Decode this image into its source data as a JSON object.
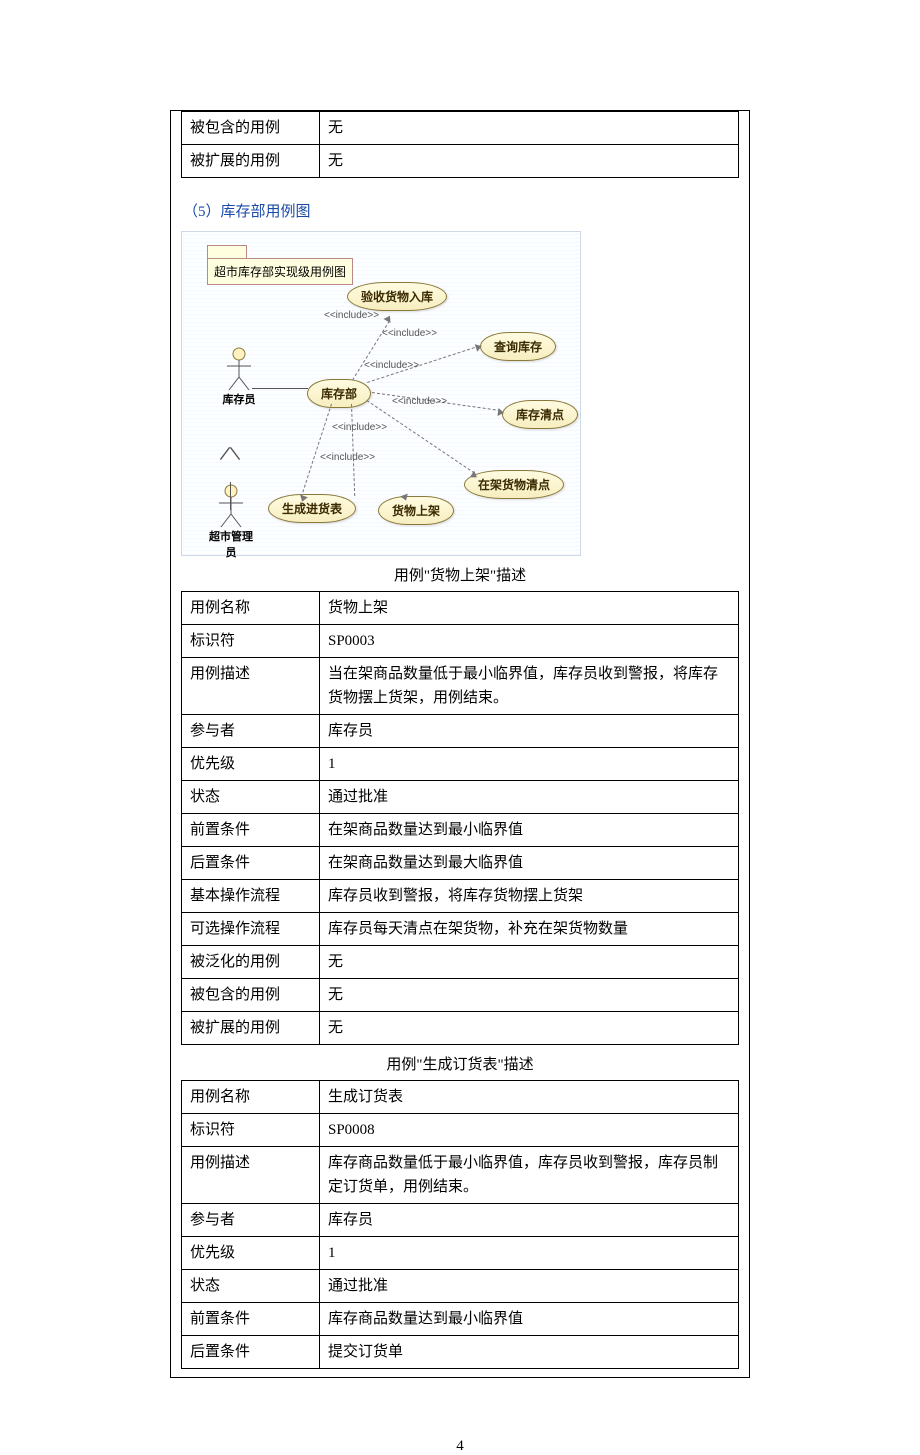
{
  "top_table": {
    "rows": [
      {
        "label": "被包含的用例",
        "value": "无"
      },
      {
        "label": "被扩展的用例",
        "value": "无"
      }
    ]
  },
  "section_title": "（5）库存部用例图",
  "diagram": {
    "title": "超市库存部实现级用例图",
    "actors": {
      "stock_clerk": "库存员",
      "admin": "超市管理员"
    },
    "usecases": {
      "store_dept": "库存部",
      "accept_goods": "验收货物入库",
      "query_stock": "查询库存",
      "stock_count": "库存清点",
      "shelf_count": "在架货物清点",
      "gen_purchase": "生成进货表",
      "shelve_goods": "货物上架"
    },
    "stereotype": "<<include>>"
  },
  "caption1": "用例\"货物上架\"描述",
  "table1": {
    "rows": [
      {
        "label": "用例名称",
        "value": "货物上架"
      },
      {
        "label": "标识符",
        "value": "SP0003"
      },
      {
        "label": "用例描述",
        "value": "当在架商品数量低于最小临界值，库存员收到警报，将库存货物摆上货架，用例结束。"
      },
      {
        "label": "参与者",
        "value": "库存员"
      },
      {
        "label": "优先级",
        "value": "1"
      },
      {
        "label": "状态",
        "value": "通过批准"
      },
      {
        "label": "前置条件",
        "value": "在架商品数量达到最小临界值"
      },
      {
        "label": "后置条件",
        "value": "在架商品数量达到最大临界值"
      },
      {
        "label": "基本操作流程",
        "value": "库存员收到警报，将库存货物摆上货架"
      },
      {
        "label": "可选操作流程",
        "value": "库存员每天清点在架货物，补充在架货物数量"
      },
      {
        "label": "被泛化的用例",
        "value": "无"
      },
      {
        "label": "被包含的用例",
        "value": "无"
      },
      {
        "label": "被扩展的用例",
        "value": "无"
      }
    ]
  },
  "caption2": "用例\"生成订货表\"描述",
  "table2": {
    "rows": [
      {
        "label": "用例名称",
        "value": "生成订货表"
      },
      {
        "label": "标识符",
        "value": "SP0008"
      },
      {
        "label": "用例描述",
        "value": "库存商品数量低于最小临界值，库存员收到警报，库存员制定订货单，用例结束。"
      },
      {
        "label": "参与者",
        "value": "库存员"
      },
      {
        "label": "优先级",
        "value": "1"
      },
      {
        "label": "状态",
        "value": "通过批准"
      },
      {
        "label": "前置条件",
        "value": "库存商品数量达到最小临界值"
      },
      {
        "label": "后置条件",
        "value": "提交订货单"
      }
    ]
  },
  "page_number": "4"
}
